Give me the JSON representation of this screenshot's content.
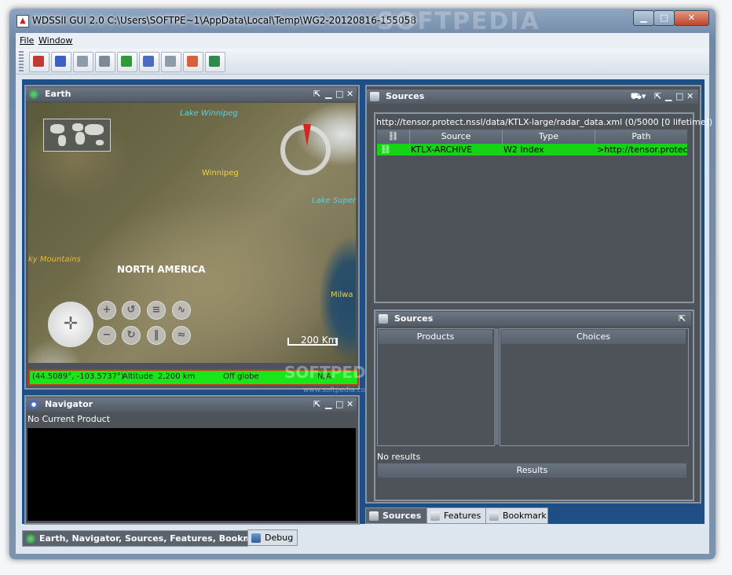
{
  "window": {
    "title": "WDSSII GUI 2.0 C:\\Users\\SOFTPE~1\\AppData\\Local\\Temp\\WG2-20120816-155058",
    "watermark": "SOFTPEDIA",
    "watermark_url": "www.softpedia.com"
  },
  "menu": {
    "file": "File",
    "window": "Window"
  },
  "toolbar": {
    "buttons": [
      {
        "name": "bar-chart-icon",
        "color": "#c23b32"
      },
      {
        "name": "bar-chart-blue-icon",
        "color": "#3b5fc2"
      },
      {
        "name": "cube-add-icon",
        "color": "#8d9aa7"
      },
      {
        "name": "cart-icon",
        "color": "#7c8a98"
      },
      {
        "name": "green-rect-icon",
        "color": "#2f9a38"
      },
      {
        "name": "eye-icon",
        "color": "#4a6cc0"
      },
      {
        "name": "cube-icon",
        "color": "#8d9aa7"
      },
      {
        "name": "palette-icon",
        "color": "#d8603a"
      },
      {
        "name": "globe-icon",
        "color": "#2e8a4a"
      }
    ]
  },
  "earth": {
    "title": "Earth",
    "labels": {
      "lake_winnipeg": "Lake Winnipeg",
      "winnipeg": "Winnipeg",
      "lake_superior": "Lake Super",
      "rocky_mountains": "ky Mountains",
      "north_america": "NORTH AMERICA",
      "milwaukee": "Milwa"
    },
    "scale": "200 Km",
    "status": {
      "coords": "(44.5089°, -103.5737°)",
      "altitude_label": "Altitude",
      "altitude_value": "2,200 km",
      "globe": "Off globe",
      "na": "N/A"
    }
  },
  "navigator": {
    "title": "Navigator",
    "current": "No Current Product"
  },
  "sources": {
    "title": "Sources",
    "url": "http://tensor.protect.nssl/data/KTLX-large/radar_data.xml (0/5000 [0 lifetime])",
    "columns": [
      "Source",
      "Type",
      "Path"
    ],
    "rows": [
      {
        "source": "KTLX-ARCHIVE",
        "type": "W2 Index",
        "path": ">http://tensor.protect...."
      }
    ]
  },
  "sources_lower": {
    "title": "Sources",
    "products": "Products",
    "choices": "Choices",
    "no_results": "No results",
    "results": "Results"
  },
  "right_tabs": [
    "Sources",
    "Features",
    "Bookmark"
  ],
  "bottom_tabs": [
    "Earth, Navigator, Sources, Features, Bookmark",
    "Debug"
  ]
}
